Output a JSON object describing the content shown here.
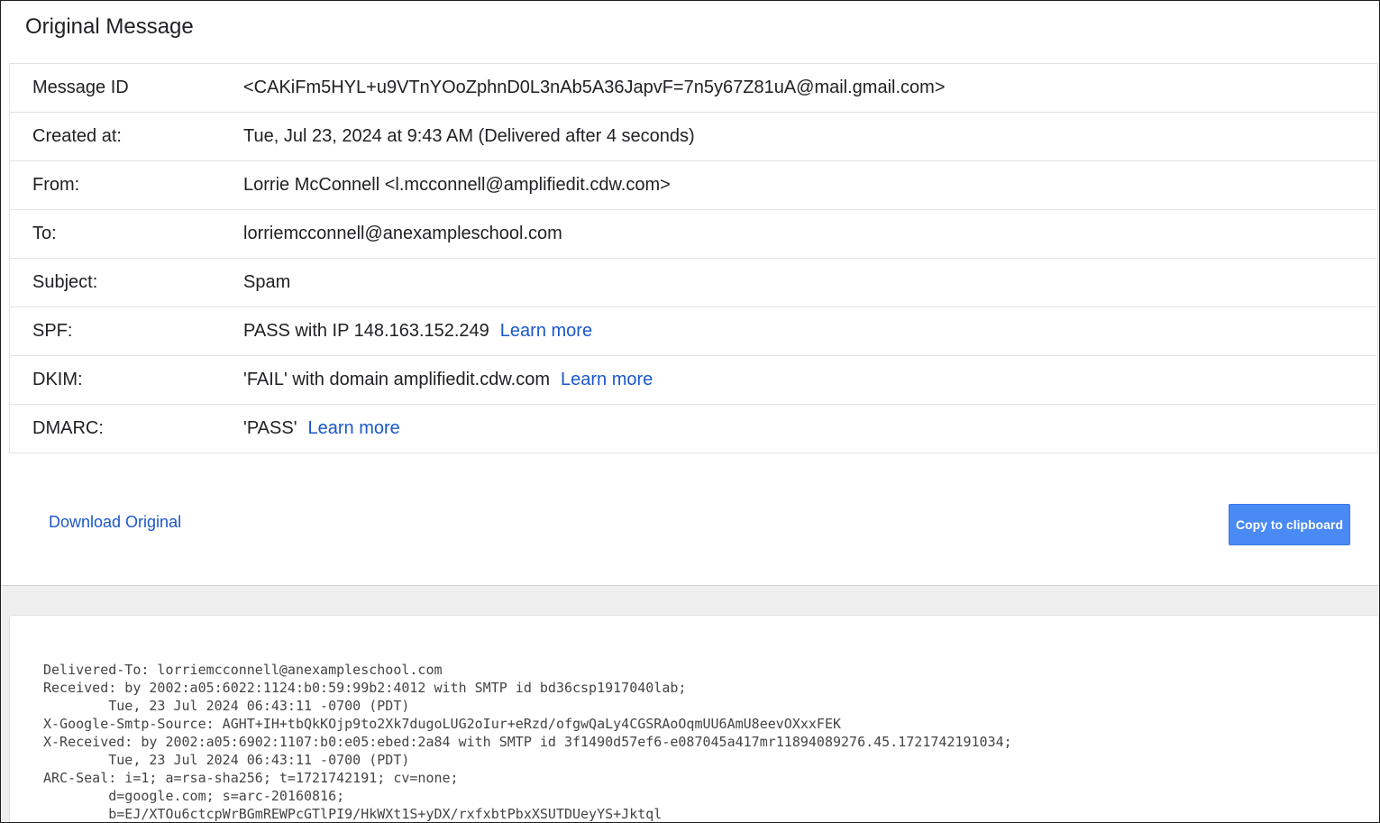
{
  "header": {
    "title": "Original Message"
  },
  "details": {
    "message_id": {
      "label": "Message ID",
      "value": "<CAKiFm5HYL+u9VTnYOoZphnD0L3nAb5A36JapvF=7n5y67Z81uA@mail.gmail.com>"
    },
    "created_at": {
      "label": "Created at:",
      "value": "Tue, Jul 23, 2024 at 9:43 AM (Delivered after 4 seconds)"
    },
    "from": {
      "label": "From:",
      "value": "Lorrie McConnell <l.mcconnell@amplifiedit.cdw.com>"
    },
    "to": {
      "label": "To:",
      "value": "lorriemcconnell@anexampleschool.com"
    },
    "subject": {
      "label": "Subject:",
      "value": "Spam"
    },
    "spf": {
      "label": "SPF:",
      "value": "PASS with IP 148.163.152.249",
      "link": "Learn more"
    },
    "dkim": {
      "label": "DKIM:",
      "value": "'FAIL' with domain amplifiedit.cdw.com",
      "link": "Learn more"
    },
    "dmarc": {
      "label": "DMARC:",
      "value": "'PASS'",
      "link": "Learn more"
    }
  },
  "actions": {
    "download_label": "Download Original",
    "copy_label": "Copy to clipboard"
  },
  "raw": {
    "lines": [
      "Delivered-To: lorriemcconnell@anexampleschool.com",
      "Received: by 2002:a05:6022:1124:b0:59:99b2:4012 with SMTP id bd36csp1917040lab;",
      "        Tue, 23 Jul 2024 06:43:11 -0700 (PDT)",
      "X-Google-Smtp-Source: AGHT+IH+tbQkKOjp9to2Xk7dugoLUG2oIur+eRzd/ofgwQaLy4CGSRAoOqmUU6AmU8eevOXxxFEK",
      "X-Received: by 2002:a05:6902:1107:b0:e05:ebed:2a84 with SMTP id 3f1490d57ef6-e087045a417mr11894089276.45.1721742191034;",
      "        Tue, 23 Jul 2024 06:43:11 -0700 (PDT)",
      "ARC-Seal: i=1; a=rsa-sha256; t=1721742191; cv=none;",
      "        d=google.com; s=arc-20160816;",
      "        b=EJ/XTOu6ctcpWrBGmREWPcGTlPI9/HkWXt1S+yDX/rxfxbtPbxXSUTDUeyYS+Jktql"
    ]
  },
  "colors": {
    "message_id": "#2e7d32",
    "link": "#1a57c9",
    "button": "#4a8af4"
  }
}
